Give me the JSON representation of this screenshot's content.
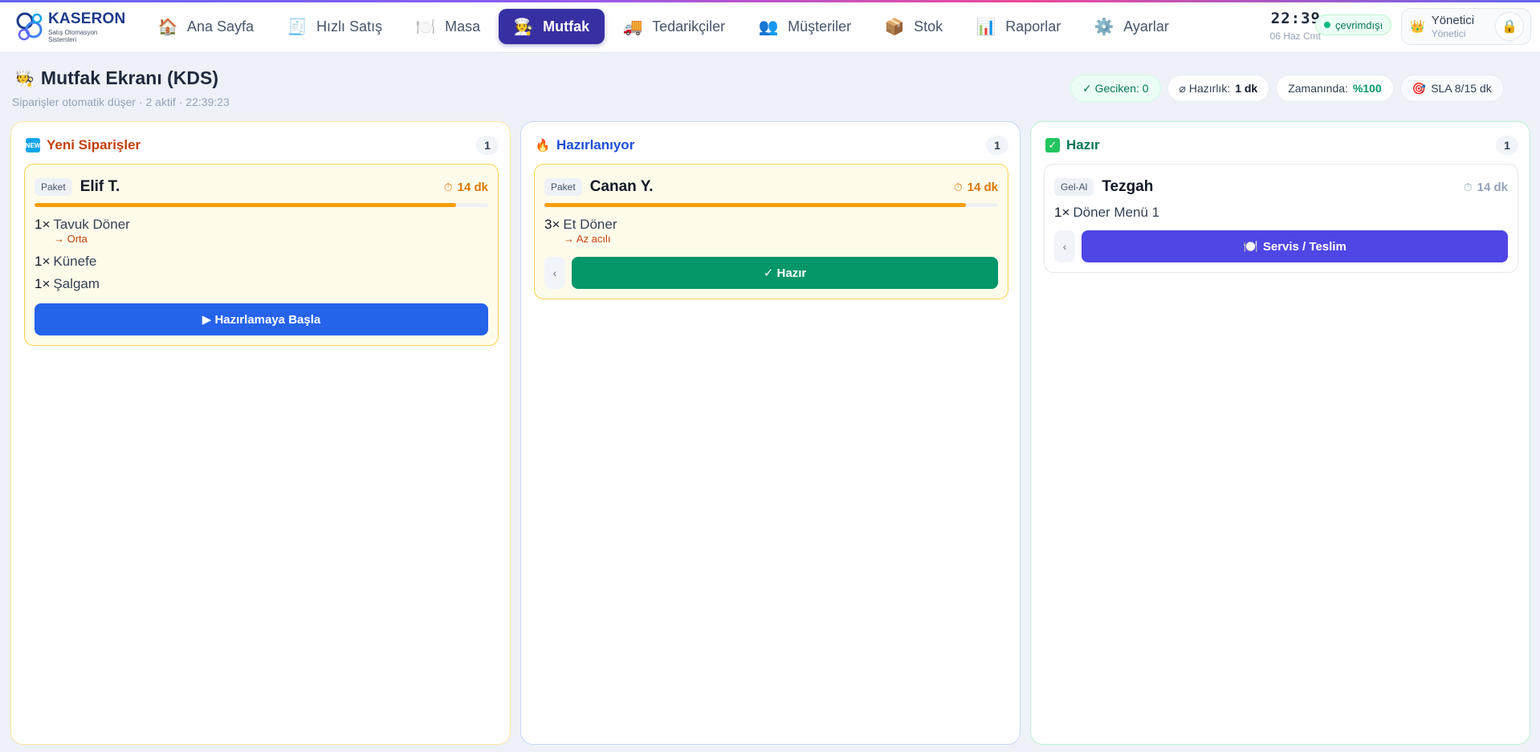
{
  "brand": {
    "name": "KASERON",
    "tagline": "Satış Otomasyon Sistemleri"
  },
  "nav": [
    {
      "label": "Ana Sayfa",
      "icon": "🏠",
      "icon_name": "home-icon",
      "active": false
    },
    {
      "label": "Hızlı Satış",
      "icon": "🧾",
      "icon_name": "receipt-icon",
      "active": false
    },
    {
      "label": "Masa",
      "icon": "🍽️",
      "icon_name": "plate-icon",
      "active": false
    },
    {
      "label": "Mutfak",
      "icon": "🧑‍🍳",
      "icon_name": "chef-icon",
      "active": true
    },
    {
      "label": "Tedarikçiler",
      "icon": "🚚",
      "icon_name": "truck-icon",
      "active": false
    },
    {
      "label": "Müşteriler",
      "icon": "👥",
      "icon_name": "users-icon",
      "active": false
    },
    {
      "label": "Stok",
      "icon": "📦",
      "icon_name": "box-icon",
      "active": false
    },
    {
      "label": "Raporlar",
      "icon": "📊",
      "icon_name": "chart-icon",
      "active": false
    },
    {
      "label": "Ayarlar",
      "icon": "⚙️",
      "icon_name": "gear-icon",
      "active": false
    }
  ],
  "clock": {
    "time": "22:39",
    "date": "06 Haz Cmt"
  },
  "connection": {
    "label": "çevrimdışı"
  },
  "user": {
    "name": "Yönetici",
    "role": "Yönetici",
    "crown": "👑",
    "lock": "🔒"
  },
  "page": {
    "icon": "🧑‍🍳",
    "title": "Mutfak Ekranı (KDS)",
    "subtitle": "Siparişler otomatik düşer · 2 aktif · 22:39:23"
  },
  "stats": {
    "late": "✓ Geciken: 0",
    "prep_label": "⌀ Hazırlık:",
    "prep_value": "1 dk",
    "ontime_label": "Zamanında:",
    "ontime_value": "%100",
    "sla": "SLA 8/15 dk",
    "sla_icon": "🎯"
  },
  "columns": {
    "new": {
      "title": "Yeni Siparişler",
      "count": "1",
      "icon_text": "NEW",
      "color": "#c2410c"
    },
    "prep": {
      "title": "Hazırlanıyor",
      "count": "1",
      "icon": "🔥",
      "color": "#1d4ed8"
    },
    "ready": {
      "title": "Hazır",
      "count": "1",
      "icon": "✓",
      "color": "#047857"
    }
  },
  "orders": {
    "new": {
      "type": "Paket",
      "name": "Elif T.",
      "elapsed": "14 dk",
      "progress": 0.93,
      "items": [
        {
          "qty": "1×",
          "name": "Tavuk Döner",
          "note": "→ Orta"
        },
        {
          "qty": "1×",
          "name": "Künefe"
        },
        {
          "qty": "1×",
          "name": "Şalgam"
        }
      ],
      "action": "▶ Hazırlamaya Başla"
    },
    "prep": {
      "type": "Paket",
      "name": "Canan Y.",
      "elapsed": "14 dk",
      "progress": 0.93,
      "items": [
        {
          "qty": "3×",
          "name": "Et Döner",
          "note": "→ Az acılı"
        }
      ],
      "back": "‹",
      "action": "✓ Hazır"
    },
    "ready": {
      "type": "Gel-Al",
      "name": "Tezgah",
      "elapsed": "14 dk",
      "items": [
        {
          "qty": "1×",
          "name": "Döner Menü 1"
        }
      ],
      "back": "‹",
      "action_icon": "🍽️",
      "action": "Servis / Teslim"
    }
  },
  "timer_icon": "⏱"
}
